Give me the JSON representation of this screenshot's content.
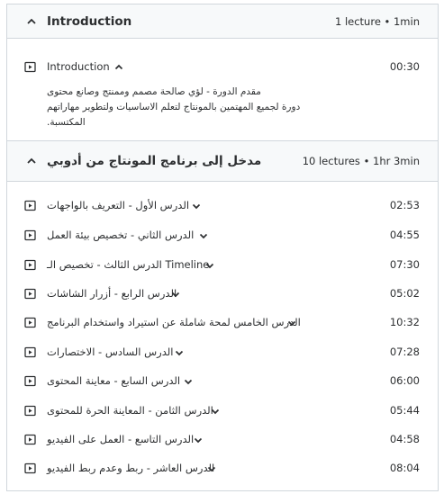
{
  "sections": [
    {
      "title": "Introduction",
      "meta": "1 lecture • 1min",
      "lectures": [
        {
          "name": "Introduction",
          "duration": "00:30",
          "description_lines": [
            "مقدم الدورة - لؤي صالحة مصمم وممنتج وصانع محتوى",
            "دورة لجميع المهتمين بالمونتاج لتعلم الاساسيات ولتطوير مهاراتهم",
            "المكتسبة."
          ]
        }
      ]
    },
    {
      "title": "مدخل إلى برنامج المونتاج من أدوبي",
      "meta": "10 lectures • 1hr 3min",
      "lectures": [
        {
          "name": "الدرس الأول - التعريف بالواجهات",
          "duration": "02:53"
        },
        {
          "name": "الدرس الثاني - تخصيص بيئة العمل",
          "duration": "04:55"
        },
        {
          "name": "الدرس الثالث - تخصيص الـ Timeline",
          "duration": "07:30"
        },
        {
          "name": "الدرس الرابع - أزرار الشاشات",
          "duration": "05:02"
        },
        {
          "name": "الدرس الخامس لمحة شاملة عن استيراد واستخدام البرنامج",
          "duration": "10:32"
        },
        {
          "name": "الدرس السادس - الاختصارات",
          "duration": "07:28"
        },
        {
          "name": "الدرس السابع - معاينة المحتوى",
          "duration": "06:00"
        },
        {
          "name": "الدرس الثامن - المعاينة الحرة للمحتوى",
          "duration": "05:44"
        },
        {
          "name": "الدرس التاسع - العمل على الفيديو",
          "duration": "04:58"
        },
        {
          "name": "الدرس العاشر - ربط وعدم ربط الفيديو",
          "duration": "08:04"
        }
      ]
    }
  ],
  "colors": {
    "header_bg": "#f7f9fa",
    "border": "#d1d7dc",
    "text": "#2d2f31"
  }
}
